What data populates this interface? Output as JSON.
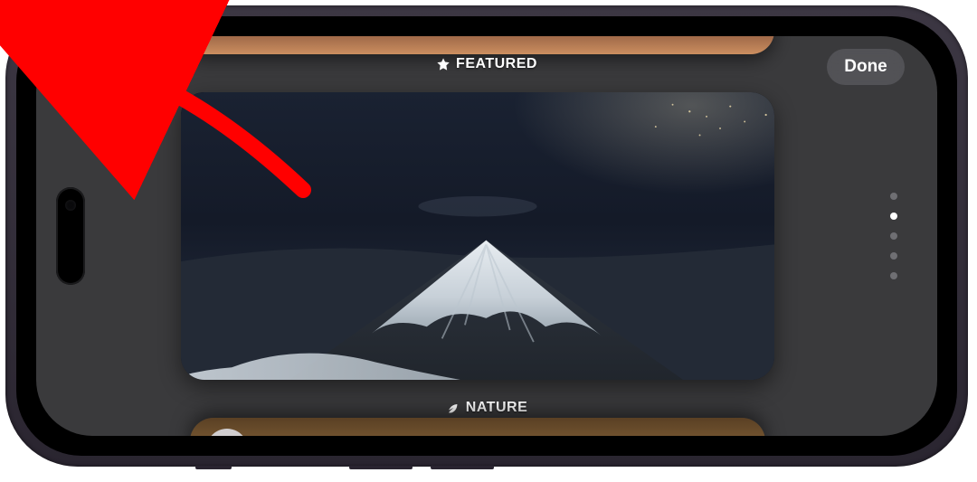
{
  "toolbar": {
    "add_symbol": "+",
    "done_label": "Done"
  },
  "categories": {
    "featured_label": "FEATURED",
    "nature_label": "NATURE"
  },
  "page_indicator": {
    "count": 5,
    "active_index": 1
  },
  "annotation": {
    "arrow_color": "#ff0000"
  },
  "wallpaper": {
    "sky_top": "#1a2232",
    "sky_mid": "#141a28",
    "horizon": "#2c3444",
    "mountain_base": "#2b3038",
    "snow_light": "#e8edf1",
    "snow_mid": "#c7d0d8",
    "snow_shadow": "#9aa6b0"
  }
}
